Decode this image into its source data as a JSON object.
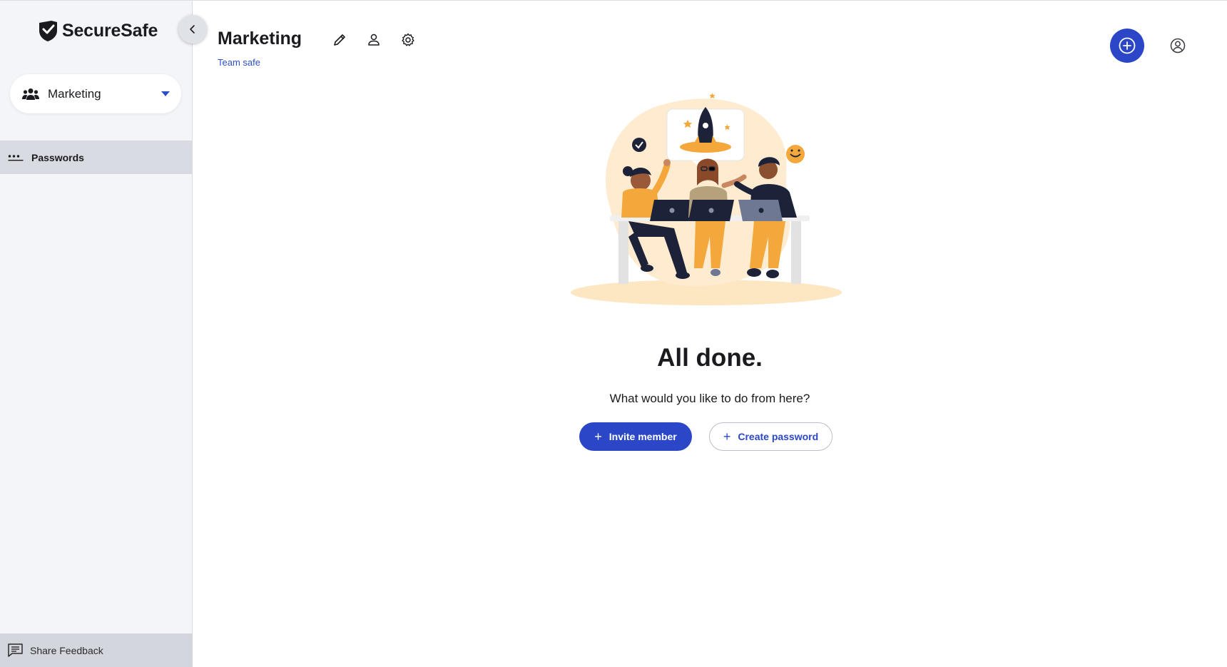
{
  "app": {
    "name": "SecureSafe"
  },
  "sidebar": {
    "team_selector": {
      "value": "Marketing"
    },
    "nav": [
      {
        "label": "Passwords",
        "icon": "dots-icon",
        "active": true
      }
    ],
    "feedback_label": "Share Feedback"
  },
  "header": {
    "title": "Marketing",
    "subtitle": "Team safe",
    "icons": [
      "pencil-icon",
      "person-icon",
      "gear-icon"
    ]
  },
  "empty_state": {
    "title": "All done.",
    "message": "What would you like to do from here?",
    "primary_button": "Invite member",
    "secondary_button": "Create password"
  },
  "colors": {
    "accent": "#2b47c7",
    "sidebar_bg": "#f3f5f8",
    "active_nav_bg": "#d8dce2",
    "illustration_orange": "#f4a73a",
    "illustration_navy": "#1c2238"
  }
}
